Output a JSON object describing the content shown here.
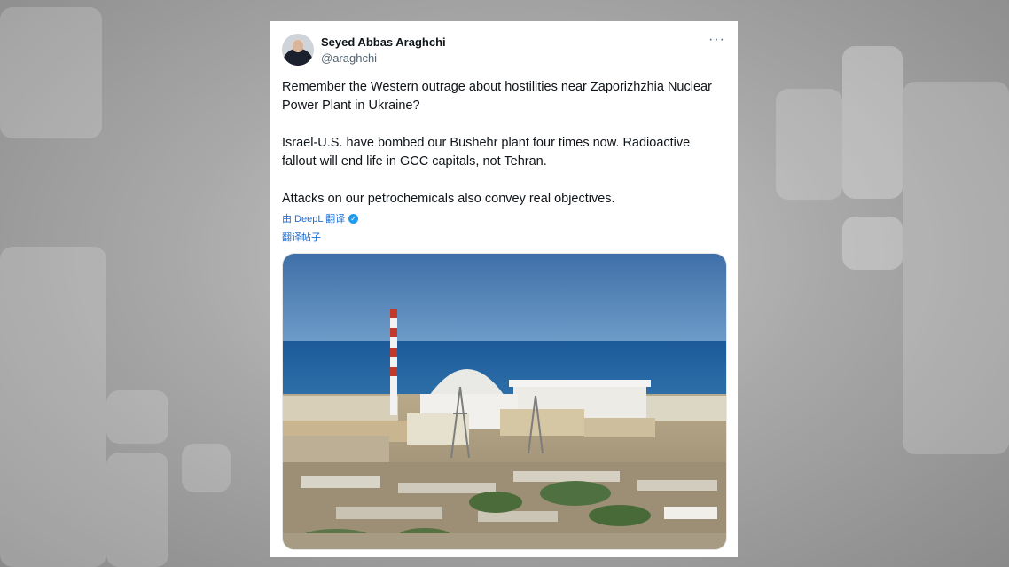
{
  "tweet": {
    "author_name": "Seyed Abbas Araghchi",
    "author_handle": "@araghchi",
    "more_icon": "more-horizontal-icon",
    "paragraphs": [
      "Remember the Western outrage about hostilities near Zaporizhzhia Nuclear Power Plant in Ukraine?",
      "Israel-U.S. have bombed our Bushehr plant four times now. Radioactive fallout will end life in GCC capitals, not Tehran.",
      "Attacks on our petrochemicals also convey real objectives."
    ],
    "translated_by": "由 DeepL 翻译",
    "translate_post": "翻译帖子",
    "accent_color": "#1d6fd6"
  }
}
